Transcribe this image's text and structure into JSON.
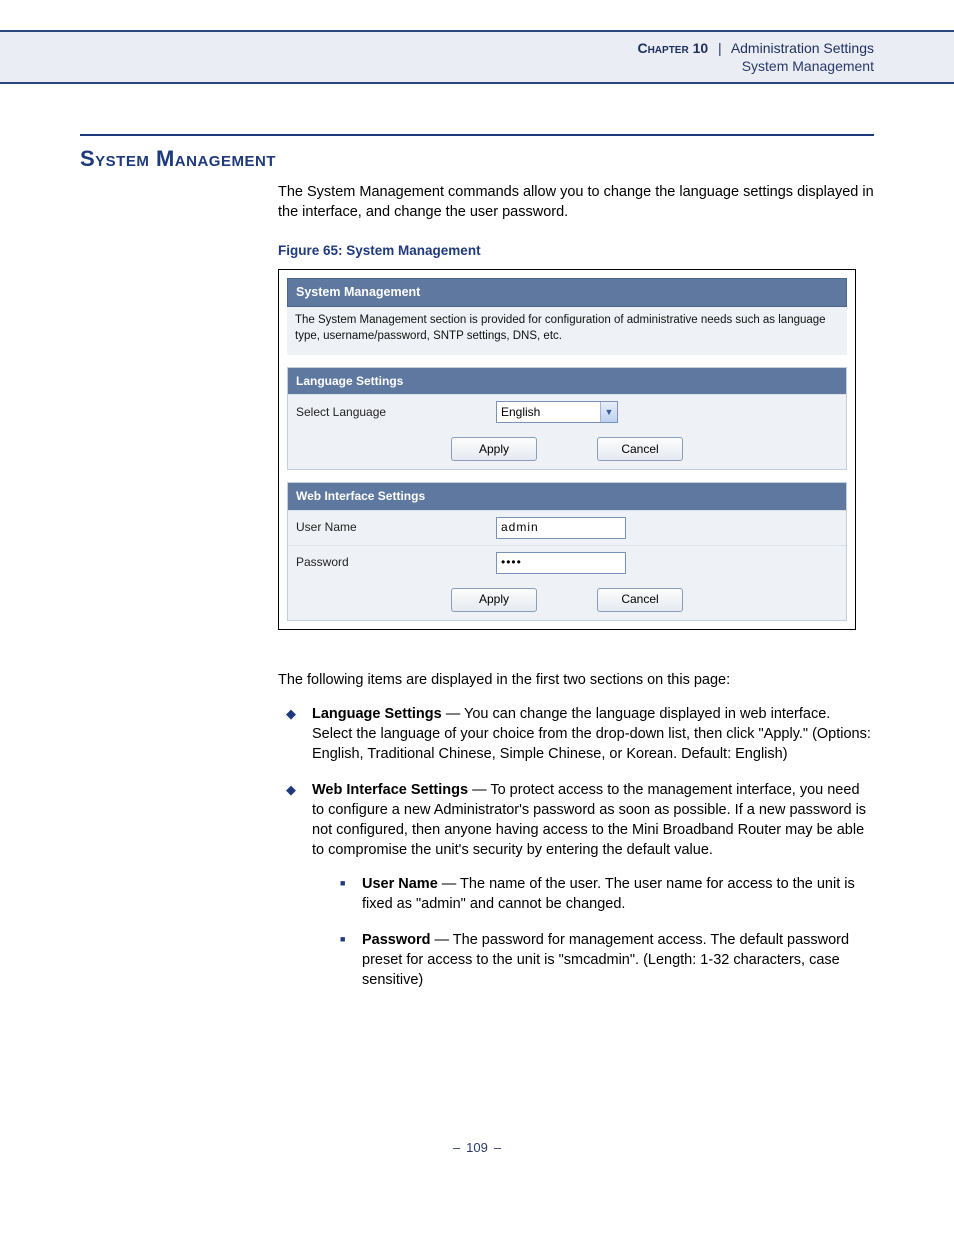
{
  "header": {
    "chapter_label": "Chapter 10",
    "separator": "|",
    "breadcrumb1": "Administration Settings",
    "breadcrumb2": "System Management"
  },
  "section": {
    "title": "System Management",
    "intro": "The System Management commands allow you to change the language settings displayed in the interface, and change the user password."
  },
  "figure": {
    "caption": "Figure 65:  System Management",
    "panel_title": "System Management",
    "panel_desc": "The System Management section is provided for configuration of administrative needs such as language type, username/password, SNTP settings, DNS, etc.",
    "lang": {
      "section_title": "Language Settings",
      "label": "Select Language",
      "value": "English",
      "apply": "Apply",
      "cancel": "Cancel"
    },
    "web": {
      "section_title": "Web Interface Settings",
      "user_label": "User Name",
      "user_value": "admin",
      "pass_label": "Password",
      "pass_value": "••••",
      "apply": "Apply",
      "cancel": "Cancel"
    }
  },
  "body": {
    "lead": "The following items are displayed in the first two sections on this page:",
    "item1_title": "Language Settings",
    "item1_body": " — You can change the language displayed in web interface. Select the language of your choice from the drop-down list, then click \"Apply.\" (Options: English, Traditional Chinese, Simple Chinese, or Korean. Default: English)",
    "item2_title": "Web Interface Settings",
    "item2_body": " — To protect access to the management interface, you need to configure a new Administrator's password as soon as possible. If a new password is not configured, then anyone having access to the Mini Broadband Router may be able to compromise the unit's security by entering the default value.",
    "sub1_title": "User Name",
    "sub1_body": " — The name of the user. The user name for access to the unit is fixed as \"admin\" and cannot be changed.",
    "sub2_title": "Password",
    "sub2_body": " — The password for management access. The default password preset for access to the unit is \"smcadmin\". (Length: 1-32 characters, case sensitive)"
  },
  "footer": {
    "page": "109"
  }
}
